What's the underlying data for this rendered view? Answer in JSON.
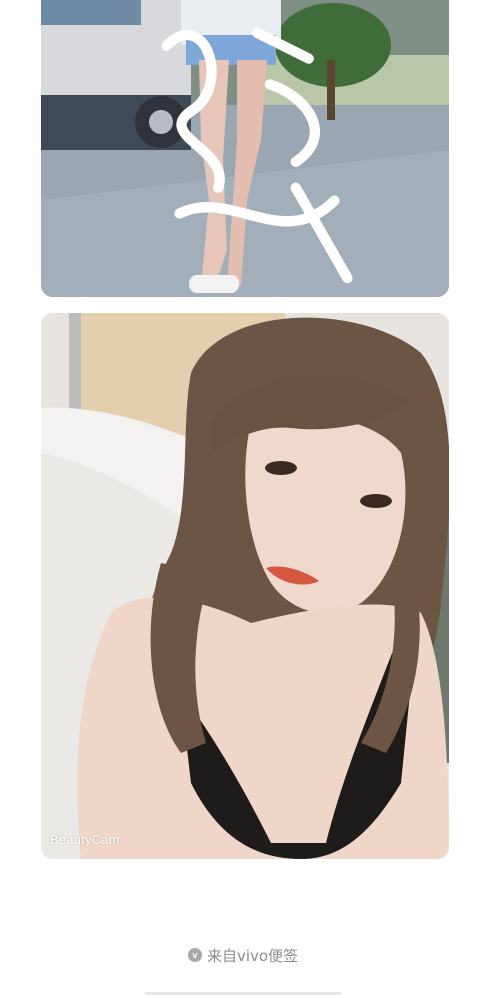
{
  "photos": [
    {
      "name": "street-photo",
      "signature_mark": "铭翔"
    },
    {
      "name": "selfie-photo",
      "watermark": "BeautyCam"
    }
  ],
  "footer": {
    "icon": "vivo-logo-icon",
    "icon_glyph": "v",
    "source_text": "来自vivo便签"
  },
  "colors": {
    "background": "#ffffff",
    "footer_text": "#8c8c8c",
    "footer_icon": "#a8a8a8"
  }
}
